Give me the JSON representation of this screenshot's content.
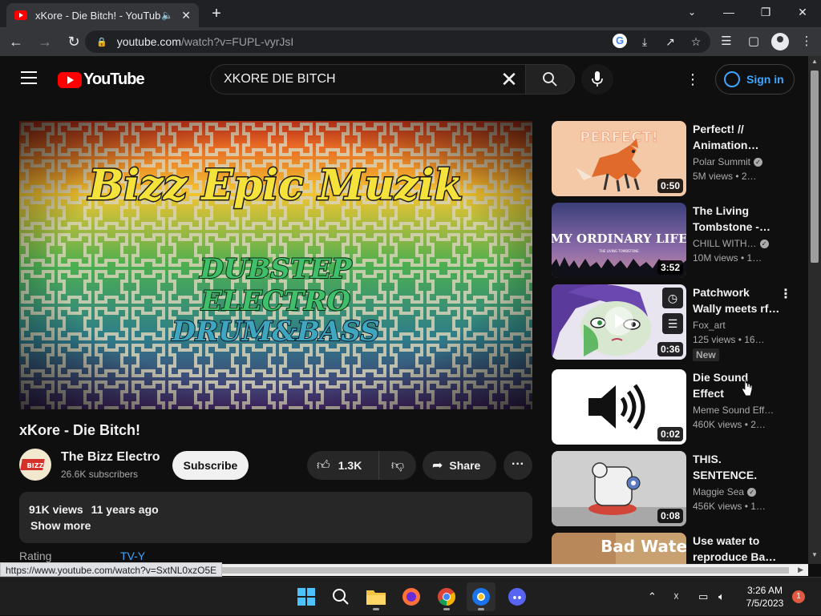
{
  "browser": {
    "tab_title": "xKore - Die Bitch! - YouTube",
    "url_host": "youtube.com",
    "url_path": "/watch?v=FUPL-vyrJsI",
    "status_url": "https://www.youtube.com/watch?v=SxtNL0xzO5E"
  },
  "header": {
    "logo_text": "YouTube",
    "search_value": "XKORE DIE BITCH",
    "signin_label": "Sign in"
  },
  "player": {
    "art_title": "Bizz Epic Muzik",
    "art_lines": [
      "DUBSTEP",
      "ELECTRO",
      "DRUM&BASS"
    ]
  },
  "video": {
    "title": "xKore - Die Bitch!",
    "channel": "The Bizz Electro",
    "avatar_text": "BIZZ",
    "subscribers": "26.6K subscribers",
    "subscribe_label": "Subscribe",
    "likes": "1.3K",
    "share_label": "Share",
    "views": "91K views",
    "age": "11 years ago",
    "show_more": "Show more",
    "rating_label": "Rating",
    "rating_value": "TV-Y"
  },
  "recommendations": [
    {
      "title": "Perfect! // Animation…",
      "channel": "Polar Summit",
      "verified": true,
      "stats": "5M views • 2…",
      "duration": "0:50",
      "thumb_text": "PERFECT!",
      "badge": ""
    },
    {
      "title": "The Living Tombstone -…",
      "channel": "CHILL WITH…",
      "verified": true,
      "stats": "10M views • 1…",
      "duration": "3:52",
      "thumb_text": "MY ORDINARY LIFE",
      "thumb_subtext": "THE LIVING TOMBSTONE",
      "badge": ""
    },
    {
      "title": "Patchwork Wally meets rf…",
      "channel": "Fox_art",
      "verified": false,
      "stats": "125 views • 16…",
      "duration": "0:36",
      "badge": "New"
    },
    {
      "title": "Die Sound Effect",
      "channel": "Meme Sound Eff…",
      "verified": false,
      "stats": "460K views • 2…",
      "duration": "0:02",
      "badge": ""
    },
    {
      "title": "THIS. SENTENCE. IS…",
      "channel": "Maggie Sea",
      "verified": true,
      "stats": "456K views • 1…",
      "duration": "0:08",
      "badge": ""
    },
    {
      "title": "Use water to reproduce Ba…",
      "channel": "",
      "verified": false,
      "stats": "",
      "duration": "",
      "thumb_text": "Bad Water",
      "badge": ""
    }
  ],
  "taskbar": {
    "time": "3:26 AM",
    "date": "7/5/2023",
    "notifications": "1"
  },
  "colors": {
    "youtube_red": "#ff0000",
    "link_blue": "#3ea6ff",
    "page_bg": "#0f0f0f"
  }
}
